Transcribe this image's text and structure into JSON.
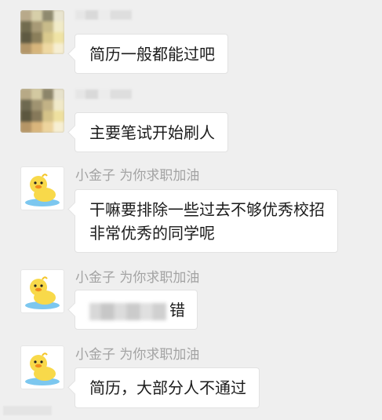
{
  "messages": [
    {
      "sender": "",
      "text": "简历一般都能过吧"
    },
    {
      "sender": "",
      "text": "主要笔试开始刷人"
    },
    {
      "sender": "小金子 为你求职加油",
      "lines": [
        "干嘛要排除一些过去不够优秀校招",
        "非常优秀的同学呢"
      ]
    },
    {
      "sender": "小金子 为你求职加油",
      "text_suffix": "错"
    },
    {
      "sender": "小金子 为你求职加油",
      "text": "简历，大部分人不通过"
    }
  ],
  "colors": {
    "background": "#efefef",
    "bubble": "#ffffff",
    "name_text": "#a3a3a3",
    "message_text": "#1b1b1b",
    "duck_yellow": "#f8d94a",
    "duck_beak": "#f08a1d",
    "water": "#7cc7ef"
  },
  "icons": {
    "avatar_blurred": "blurred-avatar",
    "avatar_duck": "yellow-duckling-icon"
  }
}
